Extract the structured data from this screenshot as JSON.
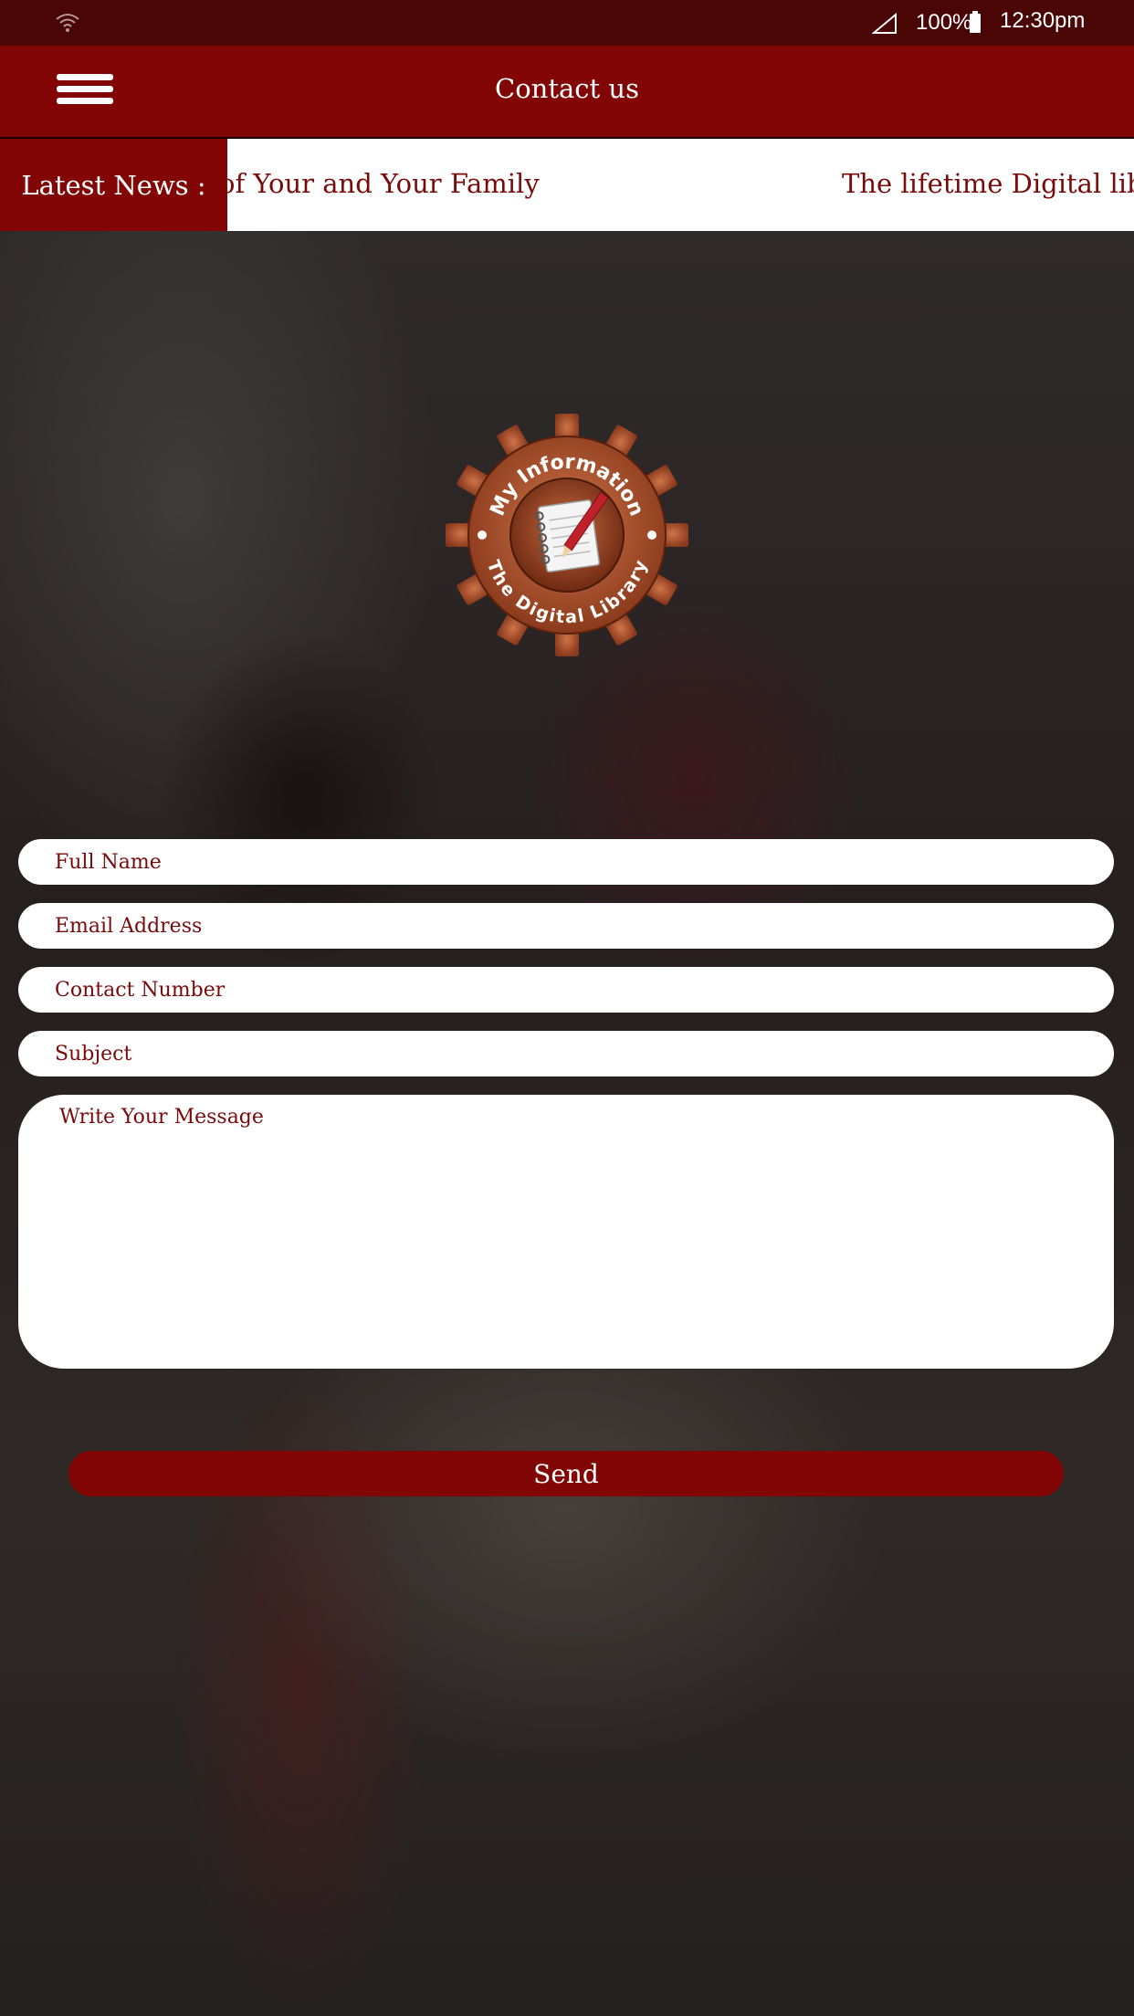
{
  "status_bar": {
    "battery": "100%",
    "time": "12:30pm",
    "icons": [
      "wifi-icon",
      "signal-icon",
      "battery-icon"
    ]
  },
  "app_bar": {
    "title": "Contact us",
    "menu_icon": "hamburger-menu-icon"
  },
  "news": {
    "label": "Latest News :",
    "items": [
      "of Your and Your Family",
      "The lifetime Digital librar"
    ]
  },
  "logo": {
    "top_text": "My Information",
    "bottom_text": "The Digital Library",
    "icon": "notebook-pencil-icon"
  },
  "form": {
    "full_name_placeholder": "Full Name",
    "email_placeholder": "Email Address",
    "contact_placeholder": "Contact Number",
    "subject_placeholder": "Subject",
    "message_placeholder": "Write Your Message",
    "send_label": "Send"
  },
  "colors": {
    "primary": "#830606",
    "status_bar": "#4a0505",
    "text_accent": "#7a0a0a"
  }
}
